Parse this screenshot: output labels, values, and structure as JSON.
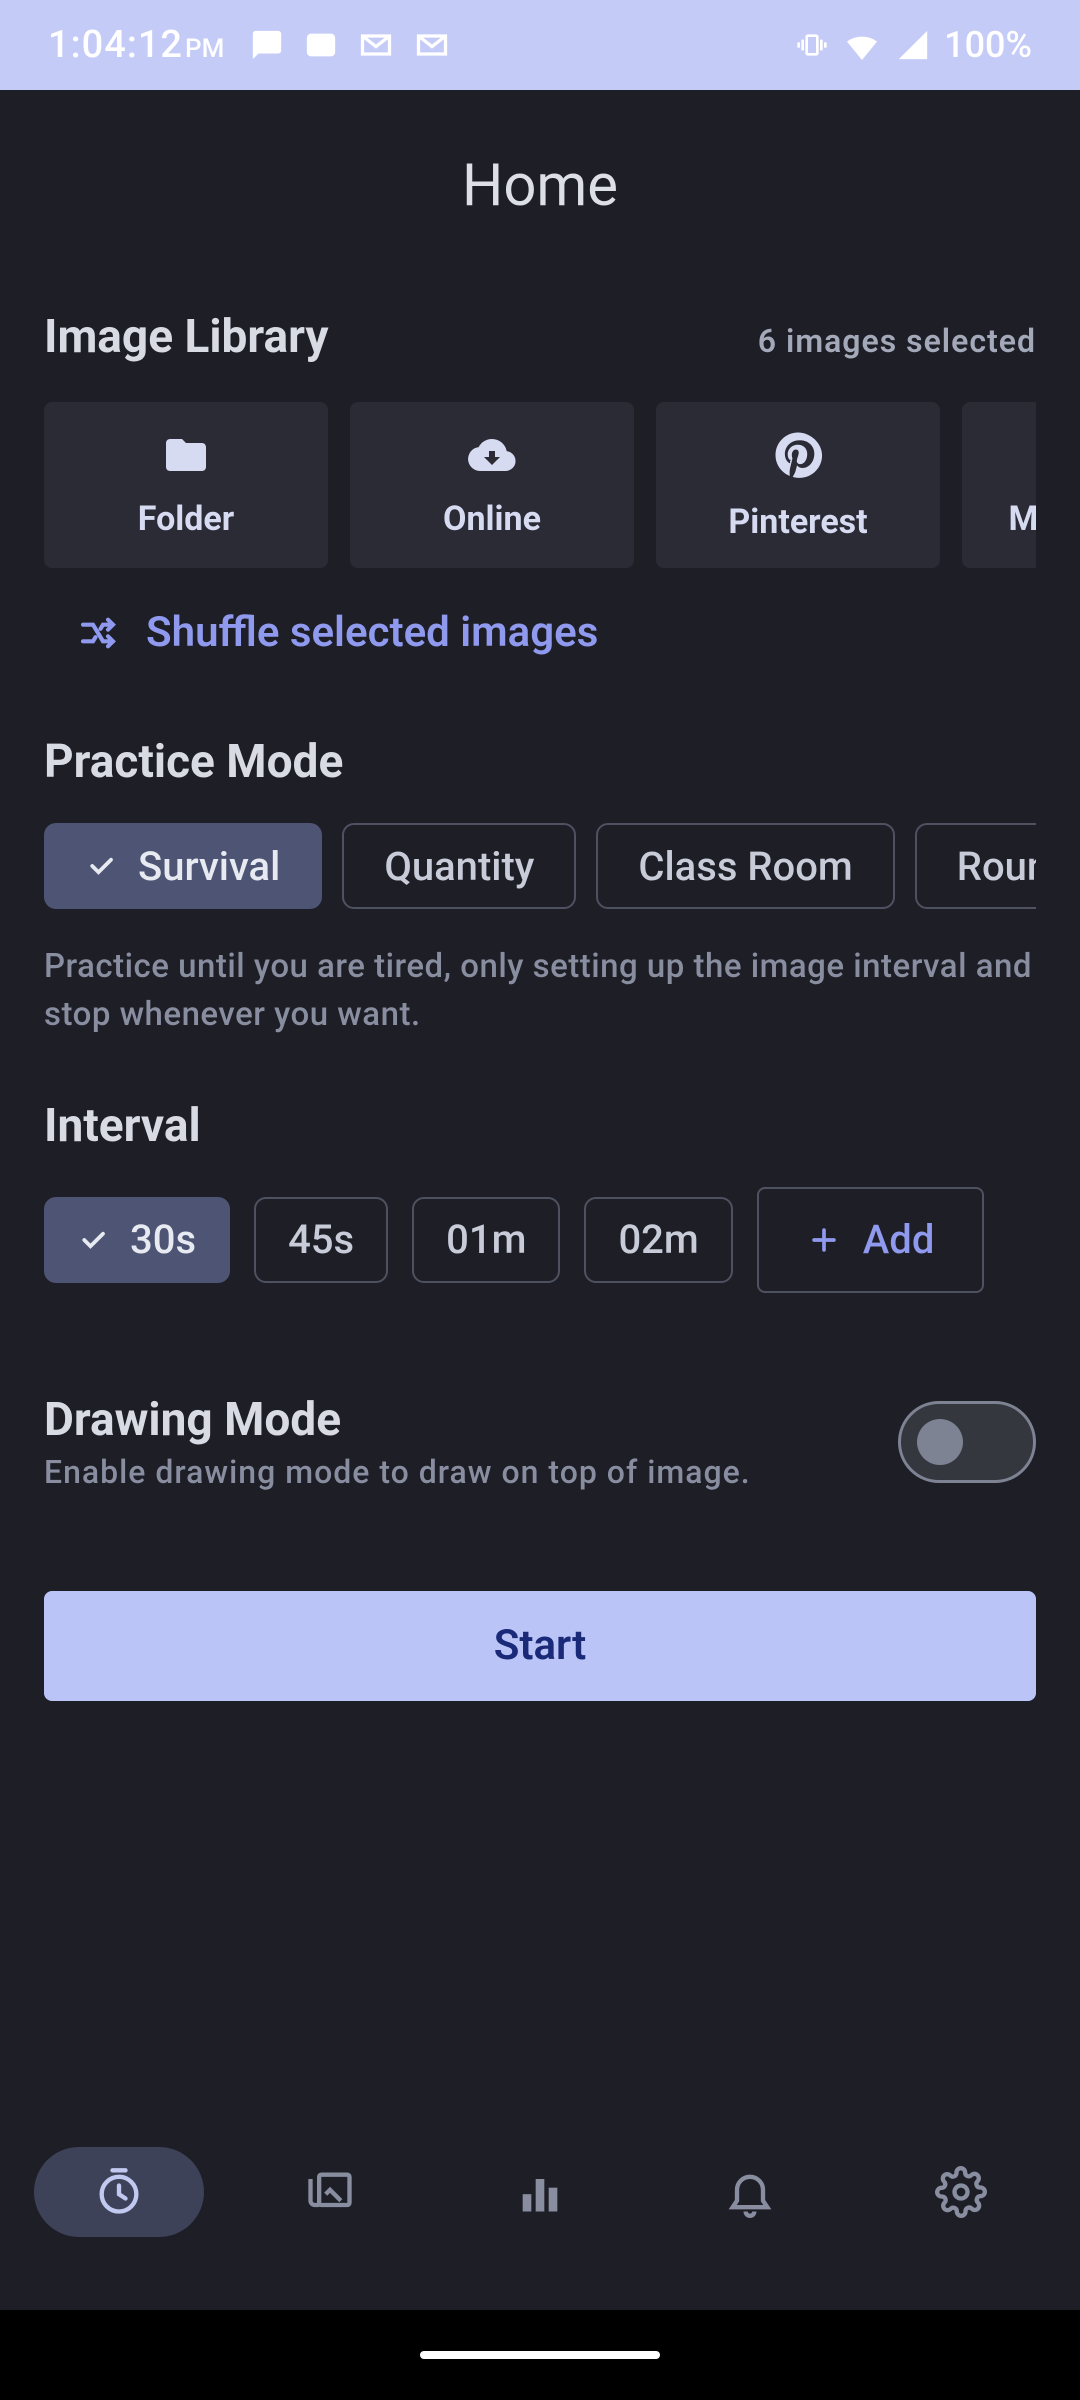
{
  "status": {
    "time": "1:04:12",
    "ampm": "PM",
    "battery": "100%"
  },
  "header": {
    "title": "Home"
  },
  "library": {
    "title": "Image Library",
    "selected_text": "6 images selected",
    "sources": [
      {
        "label": "Folder"
      },
      {
        "label": "Online"
      },
      {
        "label": "Pinterest"
      },
      {
        "label": "My"
      }
    ],
    "shuffle_label": "Shuffle selected images"
  },
  "practice": {
    "title": "Practice Mode",
    "modes": [
      {
        "label": "Survival",
        "selected": true
      },
      {
        "label": "Quantity",
        "selected": false
      },
      {
        "label": "Class Room",
        "selected": false
      },
      {
        "label": "Roun",
        "selected": false
      }
    ],
    "description": "Practice until you are tired, only setting up the image interval and stop whenever you want."
  },
  "interval": {
    "title": "Interval",
    "options": [
      {
        "label": "30s",
        "selected": true
      },
      {
        "label": "45s",
        "selected": false
      },
      {
        "label": "01m",
        "selected": false
      },
      {
        "label": "02m",
        "selected": false
      }
    ],
    "add_label": "Add"
  },
  "drawing": {
    "title": "Drawing Mode",
    "description": "Enable drawing mode to draw on top of image.",
    "enabled": false
  },
  "start_label": "Start"
}
